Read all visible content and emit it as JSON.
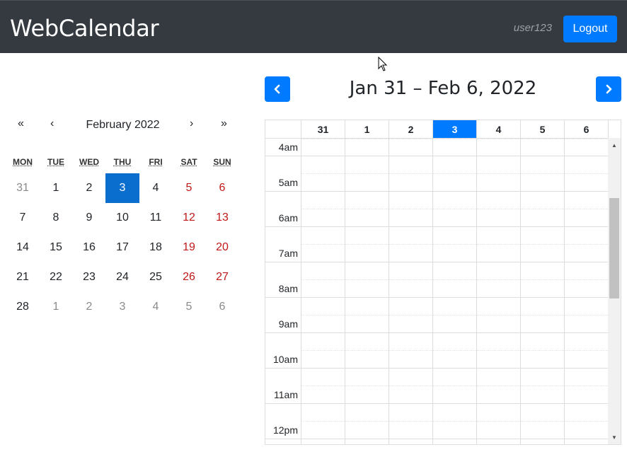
{
  "navbar": {
    "brand": "WebCalendar",
    "username": "user123",
    "logout_label": "Logout"
  },
  "mini_calendar": {
    "title": "February 2022",
    "first_label": "«",
    "prev_label": "‹",
    "next_label": "›",
    "last_label": "»",
    "weekdays": [
      "MON",
      "TUE",
      "WED",
      "THU",
      "FRI",
      "SAT",
      "SUN"
    ],
    "weeks": [
      [
        {
          "d": "31",
          "t": "other"
        },
        {
          "d": "1",
          "t": ""
        },
        {
          "d": "2",
          "t": ""
        },
        {
          "d": "3",
          "t": "today"
        },
        {
          "d": "4",
          "t": ""
        },
        {
          "d": "5",
          "t": "weekend"
        },
        {
          "d": "6",
          "t": "weekend"
        }
      ],
      [
        {
          "d": "7",
          "t": ""
        },
        {
          "d": "8",
          "t": ""
        },
        {
          "d": "9",
          "t": ""
        },
        {
          "d": "10",
          "t": ""
        },
        {
          "d": "11",
          "t": ""
        },
        {
          "d": "12",
          "t": "weekend"
        },
        {
          "d": "13",
          "t": "weekend"
        }
      ],
      [
        {
          "d": "14",
          "t": ""
        },
        {
          "d": "15",
          "t": ""
        },
        {
          "d": "16",
          "t": ""
        },
        {
          "d": "17",
          "t": ""
        },
        {
          "d": "18",
          "t": ""
        },
        {
          "d": "19",
          "t": "weekend"
        },
        {
          "d": "20",
          "t": "weekend"
        }
      ],
      [
        {
          "d": "21",
          "t": ""
        },
        {
          "d": "22",
          "t": ""
        },
        {
          "d": "23",
          "t": ""
        },
        {
          "d": "24",
          "t": ""
        },
        {
          "d": "25",
          "t": ""
        },
        {
          "d": "26",
          "t": "weekend"
        },
        {
          "d": "27",
          "t": "weekend"
        }
      ],
      [
        {
          "d": "28",
          "t": ""
        },
        {
          "d": "1",
          "t": "other"
        },
        {
          "d": "2",
          "t": "other"
        },
        {
          "d": "3",
          "t": "other"
        },
        {
          "d": "4",
          "t": "other"
        },
        {
          "d": "5",
          "t": "other"
        },
        {
          "d": "6",
          "t": "other"
        }
      ]
    ]
  },
  "week_view": {
    "title": "Jan 31 – Feb 6, 2022",
    "prev_icon": "chevron-left-icon",
    "next_icon": "chevron-right-icon",
    "days": [
      {
        "label": "31",
        "today": false
      },
      {
        "label": "1",
        "today": false
      },
      {
        "label": "2",
        "today": false
      },
      {
        "label": "3",
        "today": true
      },
      {
        "label": "4",
        "today": false
      },
      {
        "label": "5",
        "today": false
      },
      {
        "label": "6",
        "today": false
      }
    ],
    "hours": [
      "4am",
      "5am",
      "6am",
      "7am",
      "8am",
      "9am",
      "10am",
      "11am",
      "12pm"
    ]
  },
  "colors": {
    "navbar_bg": "#343a40",
    "primary": "#007bff",
    "today_mini": "#0a6ecf",
    "weekend": "#c01818"
  }
}
